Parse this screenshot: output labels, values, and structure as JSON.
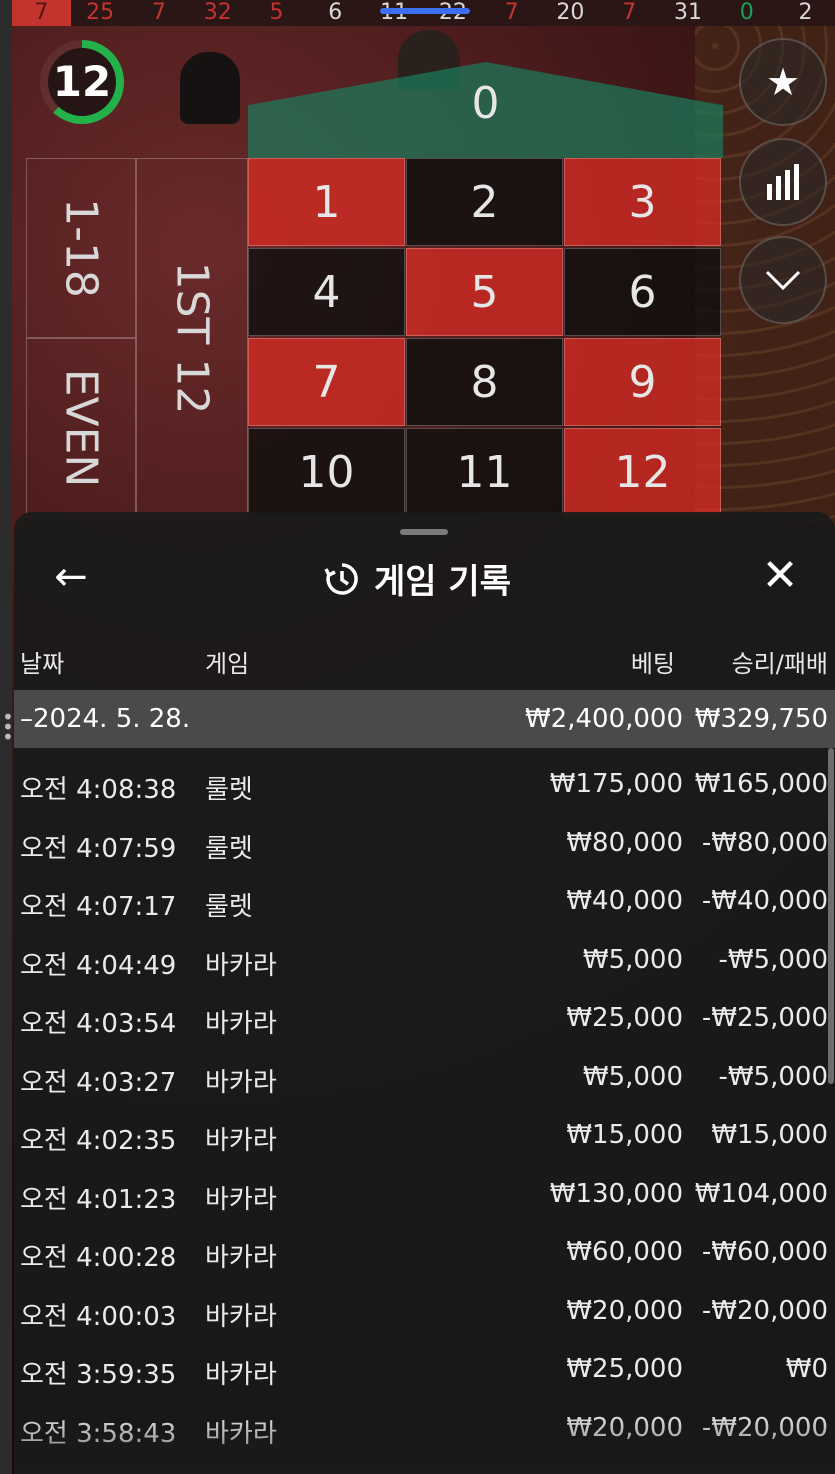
{
  "history_bar": {
    "numbers": [
      {
        "value": "7",
        "color": "red"
      },
      {
        "value": "25",
        "color": "red"
      },
      {
        "value": "7",
        "color": "red"
      },
      {
        "value": "32",
        "color": "red"
      },
      {
        "value": "5",
        "color": "red"
      },
      {
        "value": "6",
        "color": "black"
      },
      {
        "value": "11",
        "color": "black"
      },
      {
        "value": "22",
        "color": "black"
      },
      {
        "value": "7",
        "color": "red"
      },
      {
        "value": "20",
        "color": "black"
      },
      {
        "value": "7",
        "color": "red"
      },
      {
        "value": "31",
        "color": "black"
      },
      {
        "value": "0",
        "color": "green"
      },
      {
        "value": "2",
        "color": "black"
      }
    ]
  },
  "timer": {
    "value": "12",
    "progress_fraction": 0.62
  },
  "table": {
    "zero": "0",
    "cells": [
      {
        "n": "1",
        "c": "red"
      },
      {
        "n": "2",
        "c": "black"
      },
      {
        "n": "3",
        "c": "red"
      },
      {
        "n": "4",
        "c": "black"
      },
      {
        "n": "5",
        "c": "red"
      },
      {
        "n": "6",
        "c": "black"
      },
      {
        "n": "7",
        "c": "red"
      },
      {
        "n": "8",
        "c": "black"
      },
      {
        "n": "9",
        "c": "red"
      },
      {
        "n": "10",
        "c": "black"
      },
      {
        "n": "11",
        "c": "black"
      },
      {
        "n": "12",
        "c": "red"
      }
    ],
    "outside_1_18": "1-18",
    "outside_even": "EVEN",
    "dozen_1st": "1ST 12"
  },
  "side_buttons": {
    "favorite_icon": "star-icon",
    "stats_icon": "bar-chart-icon",
    "collapse_icon": "chevron-down-icon"
  },
  "panel": {
    "title": "게임 기록",
    "columns": {
      "date": "날짜",
      "game": "게임",
      "bet": "베팅",
      "result": "승리/패배"
    },
    "date_group": {
      "label": "–2024. 5. 28.",
      "bet": "₩2,400,000",
      "result": "₩329,750"
    },
    "rows": [
      {
        "time": "오전 4:08:38",
        "game": "룰렛",
        "bet": "₩175,000",
        "result": "₩165,000"
      },
      {
        "time": "오전 4:07:59",
        "game": "룰렛",
        "bet": "₩80,000",
        "result": "-₩80,000"
      },
      {
        "time": "오전 4:07:17",
        "game": "룰렛",
        "bet": "₩40,000",
        "result": "-₩40,000"
      },
      {
        "time": "오전 4:04:49",
        "game": "바카라",
        "bet": "₩5,000",
        "result": "-₩5,000"
      },
      {
        "time": "오전 4:03:54",
        "game": "바카라",
        "bet": "₩25,000",
        "result": "-₩25,000"
      },
      {
        "time": "오전 4:03:27",
        "game": "바카라",
        "bet": "₩5,000",
        "result": "-₩5,000"
      },
      {
        "time": "오전 4:02:35",
        "game": "바카라",
        "bet": "₩15,000",
        "result": "₩15,000"
      },
      {
        "time": "오전 4:01:23",
        "game": "바카라",
        "bet": "₩130,000",
        "result": "₩104,000"
      },
      {
        "time": "오전 4:00:28",
        "game": "바카라",
        "bet": "₩60,000",
        "result": "-₩60,000"
      },
      {
        "time": "오전 4:00:03",
        "game": "바카라",
        "bet": "₩20,000",
        "result": "-₩20,000"
      },
      {
        "time": "오전 3:59:35",
        "game": "바카라",
        "bet": "₩25,000",
        "result": "₩0"
      },
      {
        "time": "오전 3:58:43",
        "game": "바카라",
        "bet": "₩20,000",
        "result": "-₩20,000"
      }
    ]
  },
  "colors": {
    "red": "#d62c24",
    "black": "#0f0f0f",
    "green": "#1c7a5c",
    "timer": "#24b14a",
    "panel_bg": "#1a1a1a",
    "date_row_bg": "#4a4a4a"
  }
}
